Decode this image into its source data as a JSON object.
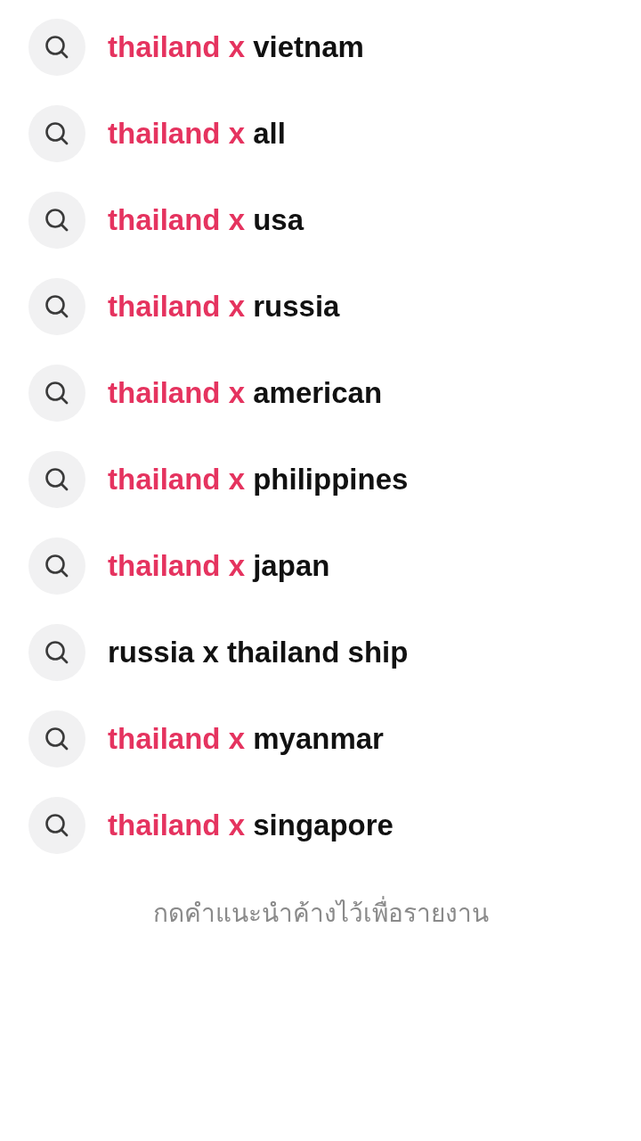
{
  "suggestions": [
    {
      "highlight": "thailand x",
      "rest": "vietnam"
    },
    {
      "highlight": "thailand x",
      "rest": "all"
    },
    {
      "highlight": "thailand x",
      "rest": "usa"
    },
    {
      "highlight": "thailand x",
      "rest": "russia"
    },
    {
      "highlight": "thailand x",
      "rest": "american"
    },
    {
      "highlight": "thailand x",
      "rest": "philippines"
    },
    {
      "highlight": "thailand x",
      "rest": "japan"
    },
    {
      "rest": "russia x thailand ship"
    },
    {
      "highlight": "thailand x",
      "rest": "myanmar"
    },
    {
      "highlight": "thailand x",
      "rest": "singapore"
    }
  ],
  "footer_hint": "กดคำแนะนำค้างไว้เพื่อรายงาน"
}
